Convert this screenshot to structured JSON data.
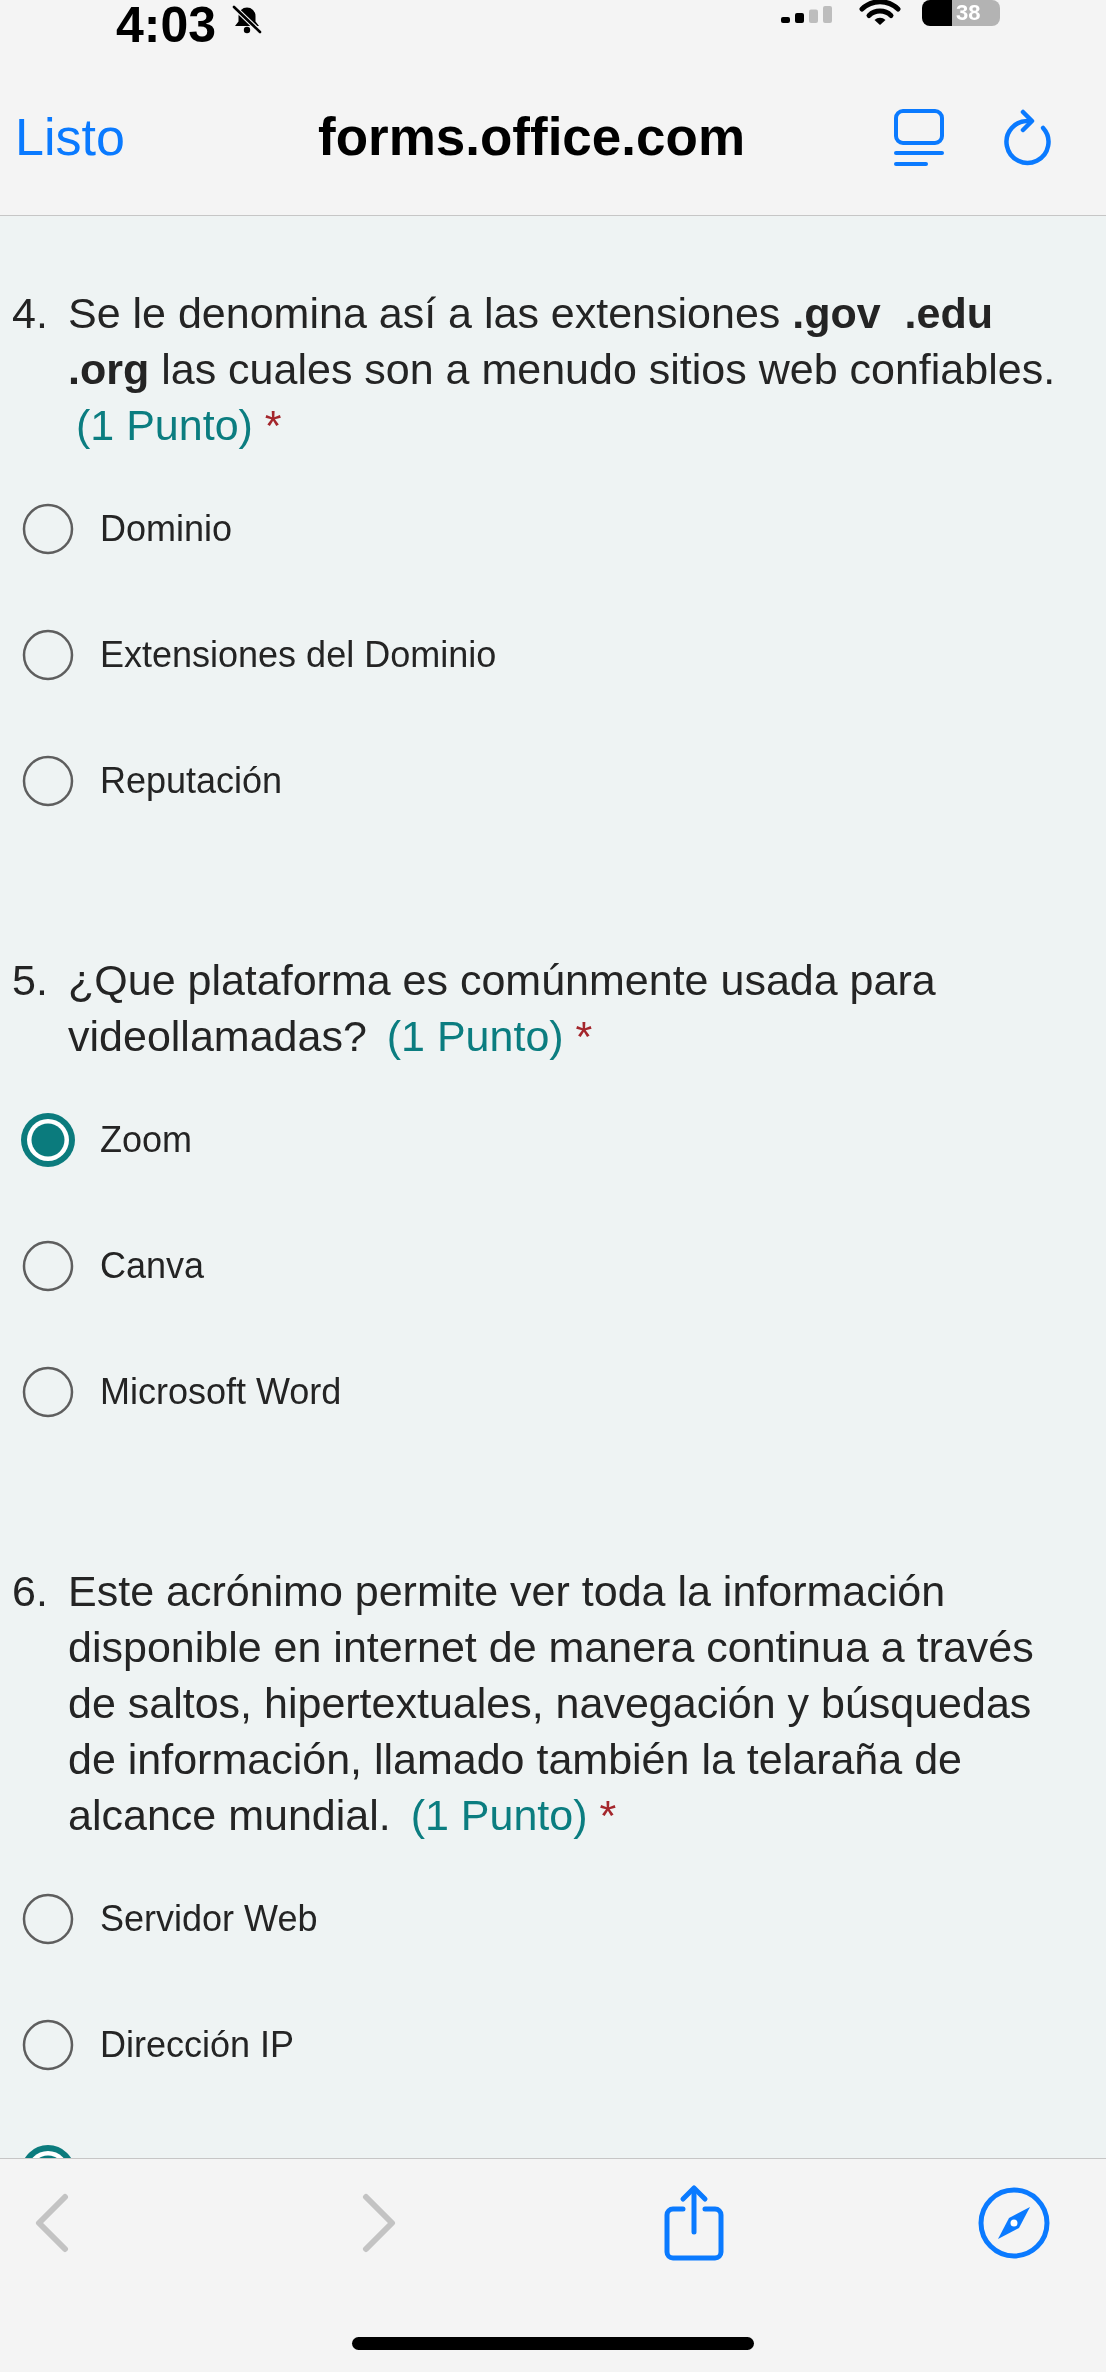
{
  "status_bar": {
    "time": "4:03",
    "silent": true,
    "battery": "38"
  },
  "browser_bar": {
    "done": "Listo",
    "address": "forms.office.com"
  },
  "questions": [
    {
      "number": "4.",
      "text": "Se le denomina así a las extensiones **.gov**  **.edu** **.org** las cuales son a menudo sitios web confiables.",
      "points": "(1 Punto)",
      "required_mark": "*",
      "options": [
        {
          "label": "Dominio",
          "selected": false
        },
        {
          "label": "Extensiones del Dominio",
          "selected": false
        },
        {
          "label": "Reputación",
          "selected": false
        }
      ]
    },
    {
      "number": "5.",
      "text": "¿Que plataforma es comúnmente usada para videollamadas?",
      "points": "(1 Punto)",
      "required_mark": "*",
      "options": [
        {
          "label": "Zoom",
          "selected": true
        },
        {
          "label": "Canva",
          "selected": false
        },
        {
          "label": "Microsoft Word",
          "selected": false
        }
      ]
    },
    {
      "number": "6.",
      "text": "Este acrónimo permite ver toda la información disponible en internet de manera continua a través de saltos, hipertextuales, navegación y búsquedas de información, llamado también la telaraña de alcance mundial.",
      "points": "(1 Punto)",
      "required_mark": "*",
      "options": [
        {
          "label": "Servidor Web",
          "selected": false
        },
        {
          "label": "Dirección IP",
          "selected": false
        },
        {
          "selected": true
        }
      ]
    }
  ],
  "toolbar": [
    {
      "kind": "back",
      "disabled": true
    },
    {
      "kind": "forward",
      "disabled": true
    },
    {
      "kind": "share",
      "disabled": false
    },
    {
      "kind": "compass",
      "disabled": false
    }
  ]
}
